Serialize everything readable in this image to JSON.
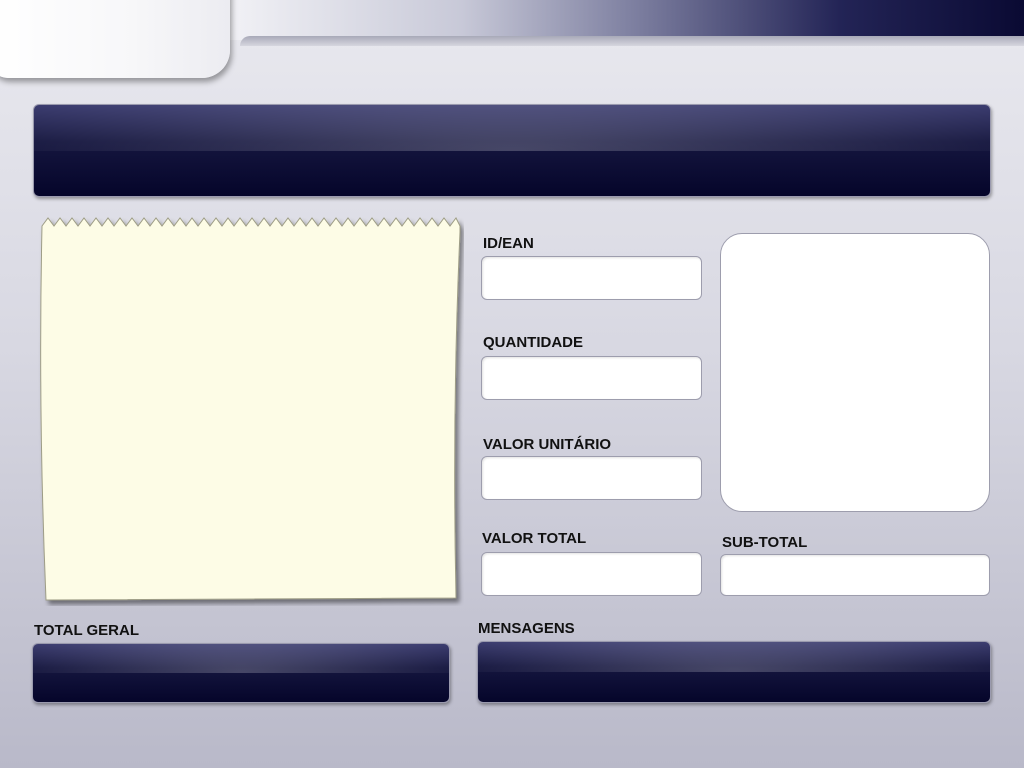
{
  "header": {
    "display_text": ""
  },
  "receipt": {
    "lines": ""
  },
  "fields": {
    "id_ean": {
      "label": "ID/EAN",
      "value": ""
    },
    "quantidade": {
      "label": "QUANTIDADE",
      "value": ""
    },
    "valor_unitario": {
      "label": "VALOR UNITÁRIO",
      "value": ""
    },
    "valor_total": {
      "label": "VALOR TOTAL",
      "value": ""
    },
    "sub_total": {
      "label": "SUB-TOTAL",
      "value": ""
    }
  },
  "total_geral": {
    "label": "TOTAL GERAL",
    "value": ""
  },
  "mensagens": {
    "label": "MENSAGENS",
    "value": ""
  },
  "colors": {
    "panel_dark": "#05052a",
    "receipt_paper": "#fdfce6",
    "background": "#d8d8e2"
  }
}
